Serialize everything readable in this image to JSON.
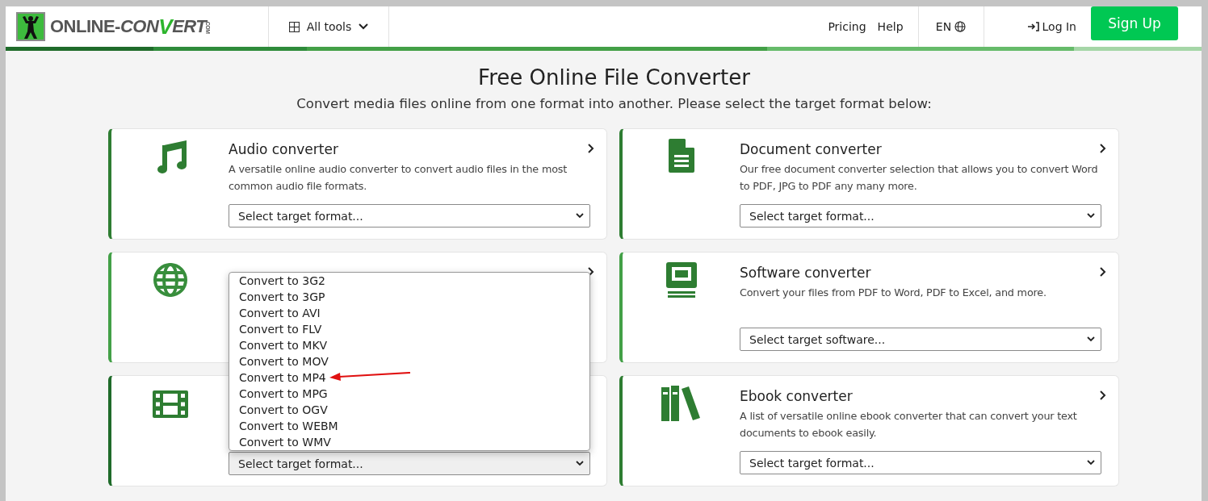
{
  "header": {
    "logo": {
      "prefix": "ONLINE-",
      "brand_start": "CON",
      "brand_mark": "V",
      "brand_end": "ERT",
      "suffix": ".COM"
    },
    "all_tools": "All tools",
    "nav": [
      "Pricing",
      "Help"
    ],
    "language": "EN",
    "login": "Log In",
    "signup": "Sign Up"
  },
  "hero": {
    "title": "Free Online File Converter",
    "subtitle": "Convert media files online from one format into another. Please select the target format below:"
  },
  "cards": [
    {
      "kind": "audio",
      "title": "Audio converter",
      "description": "A versatile online audio converter to convert audio files in the most common audio file formats.",
      "select": "Select target format..."
    },
    {
      "kind": "document",
      "title": "Document converter",
      "description": "Our free document converter selection that allows you to convert Word to PDF, JPG to PDF any many more.",
      "select": "Select target format..."
    },
    {
      "kind": "web"
    },
    {
      "kind": "software",
      "title": "Software converter",
      "description": "Convert your files from PDF to Word, PDF to Excel, and more.",
      "select": "Select target software..."
    },
    {
      "kind": "video",
      "select": "Select target format...",
      "dropdown": [
        {
          "label": "Convert to 3G2",
          "annotated": false
        },
        {
          "label": "Convert to 3GP",
          "annotated": false
        },
        {
          "label": "Convert to AVI",
          "annotated": false
        },
        {
          "label": "Convert to FLV",
          "annotated": false
        },
        {
          "label": "Convert to MKV",
          "annotated": false
        },
        {
          "label": "Convert to MOV",
          "annotated": false
        },
        {
          "label": "Convert to MP4",
          "annotated": true
        },
        {
          "label": "Convert to MPG",
          "annotated": false
        },
        {
          "label": "Convert to OGV",
          "annotated": false
        },
        {
          "label": "Convert to WEBM",
          "annotated": false
        },
        {
          "label": "Convert to WMV",
          "annotated": false
        }
      ]
    },
    {
      "kind": "ebook",
      "title": "Ebook converter",
      "description": "A list of versatile online ebook converter that can convert your text documents to ebook easily.",
      "select": "Select target format..."
    }
  ]
}
